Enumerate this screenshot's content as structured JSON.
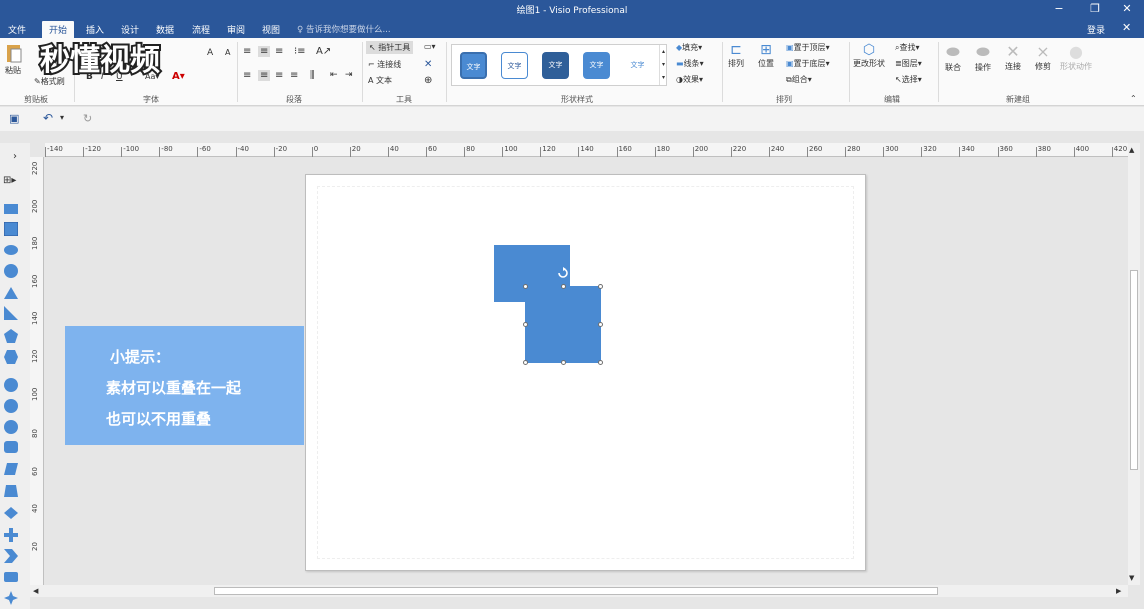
{
  "window": {
    "title": "绘图1 - Visio Professional",
    "minimize": "−",
    "restore": "❐",
    "close": "✕"
  },
  "tabs": [
    "文件",
    "开始",
    "插入",
    "设计",
    "数据",
    "流程",
    "审阅",
    "视图"
  ],
  "active_tab": "开始",
  "tellme": "告诉我你想要做什么...",
  "login": "登录",
  "ribbon": {
    "groups": [
      "剪贴板",
      "字体",
      "段落",
      "工具",
      "形状样式",
      "排列",
      "编辑",
      "新建组"
    ],
    "clipboard": {
      "paste": "粘贴",
      "format_painter": "格式刷"
    },
    "tools": {
      "pointer": "指针工具",
      "connector": "连接线",
      "text": "文本"
    },
    "style_items": [
      "文字",
      "文字",
      "文字",
      "文字",
      "文字"
    ],
    "shape_fmt": {
      "fill": "填充",
      "line": "线条",
      "effect": "效果"
    },
    "arrange": {
      "align": "排列",
      "position": "位置",
      "bring_front": "置于顶层",
      "send_back": "置于底层",
      "group": "组合"
    },
    "edit": {
      "change_shape": "更改形状",
      "find": "查找",
      "layers": "图层",
      "select": "选择"
    },
    "new_group": {
      "union": "联合",
      "operate": "操作",
      "connect": "连接",
      "trim": "修剪",
      "animate": "形状动作"
    }
  },
  "ruler": {
    "h_labels": [
      "-140",
      "-120",
      "-100",
      "-80",
      "-60",
      "-40",
      "-20",
      "0",
      "20",
      "40",
      "60",
      "80",
      "100",
      "120",
      "140",
      "160",
      "180",
      "200",
      "220",
      "240",
      "260",
      "280",
      "300",
      "320",
      "340",
      "360",
      "380",
      "400",
      "420"
    ],
    "v_labels": [
      "220",
      "200",
      "180",
      "160",
      "140",
      "120",
      "100",
      "80",
      "60",
      "40",
      "20",
      "0"
    ]
  },
  "tip": {
    "title": "小提示：",
    "line1": "素材可以重叠在一起",
    "line2": "也可以不用重叠"
  },
  "logo_text": "秒懂视频",
  "colors": {
    "title_bar": "#2b579a",
    "shape_fill": "#4a8ad2",
    "tip_bg": "#7eb3ee"
  }
}
